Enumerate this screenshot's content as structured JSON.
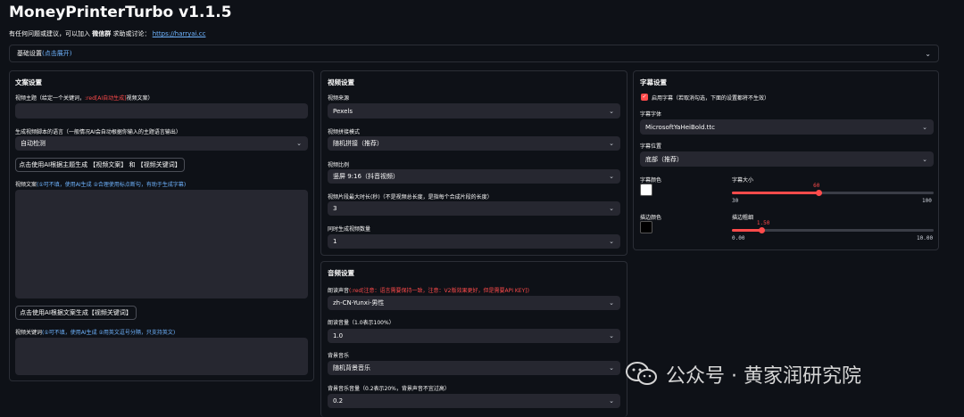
{
  "app": {
    "title": "MoneyPrinterTurbo v1.1.5",
    "subtitle_prefix": "有任何问题或建议，可以加入",
    "subtitle_bold": "微信群",
    "subtitle_mid": "求助或讨论：",
    "subtitle_link": "https://harryai.cc"
  },
  "basic_settings": {
    "label": "基础设置",
    "hint": "(点击展开)"
  },
  "script_settings": {
    "header": "文案设置",
    "topic_label": "视频主题（给定一个关键词，",
    "topic_label_red": ":red[AI自动生成]",
    "topic_label_end": "视频文案）",
    "topic_value": "",
    "language_label": "生成视频脚本的语言（一般情况AI会自动根据你输入的主题语言输出）",
    "language_value": "自动检测",
    "gen_script_button": "点击使用AI根据主题生成 【视频文案】 和 【视频关键词】",
    "script_label": "视频文案",
    "script_label_blue": "(①可不填，使用AI生成  ②合理使用标点断句，有助于生成字幕)",
    "script_value": "",
    "gen_keywords_button": "点击使用AI根据文案生成【视频关键词】",
    "keywords_label": "视频关键词",
    "keywords_label_blue": "(①可不填，使用AI生成 ②用英文逗号分隔，只支持英文)",
    "keywords_value": ""
  },
  "video_settings": {
    "header": "视频设置",
    "source_label": "视频来源",
    "source_value": "Pexels",
    "concat_label": "视频拼接模式",
    "concat_value": "随机拼接（推荐）",
    "aspect_label": "视频比例",
    "aspect_value": "竖屏 9:16（抖音视频）",
    "clip_duration_label": "视频片段最大时长(秒)（不是视频总长度，是指每个合成片段的长度）",
    "clip_duration_value": "3",
    "count_label": "同时生成视频数量",
    "count_value": "1"
  },
  "audio_settings": {
    "header": "音频设置",
    "voice_label": "朗读声音",
    "voice_label_red": "(:red[注意：语言需要保持一致，注意：V2版效果更好，但是需要API KEY])",
    "voice_value": "zh-CN-Yunxi-男性",
    "volume_label": "朗读音量（1.0表示100%）",
    "volume_value": "1.0",
    "bgm_label": "背景音乐",
    "bgm_value": "随机背景音乐",
    "bgm_volume_label": "背景音乐音量（0.2表示20%，背景声音不宜过高）",
    "bgm_volume_value": "0.2"
  },
  "subtitle_settings": {
    "header": "字幕设置",
    "enable_label": "启用字幕（若取消勾选，下面的设置都将不生效）",
    "enable_checked": true,
    "font_label": "字幕字体",
    "font_value": "MicrosoftYaHeiBold.ttc",
    "position_label": "字幕位置",
    "position_value": "底部（推荐）",
    "font_color_label": "字幕颜色",
    "font_color": "#ffffff",
    "font_size_label": "字幕大小",
    "font_size_value": "60",
    "font_size_min": "30",
    "font_size_max": "100",
    "font_size_fraction": 0.43,
    "stroke_color_label": "描边颜色",
    "stroke_color": "#000000",
    "stroke_width_label": "描边粗细",
    "stroke_width_value": "1.50",
    "stroke_width_min": "0.00",
    "stroke_width_max": "10.00",
    "stroke_width_fraction": 0.15
  },
  "watermark": {
    "text": "公众号 · 黄家润研究院"
  },
  "colors": {
    "accent": "#ff4b4b",
    "link": "#6fb4ff",
    "background": "#0e1117",
    "field": "#262730"
  }
}
